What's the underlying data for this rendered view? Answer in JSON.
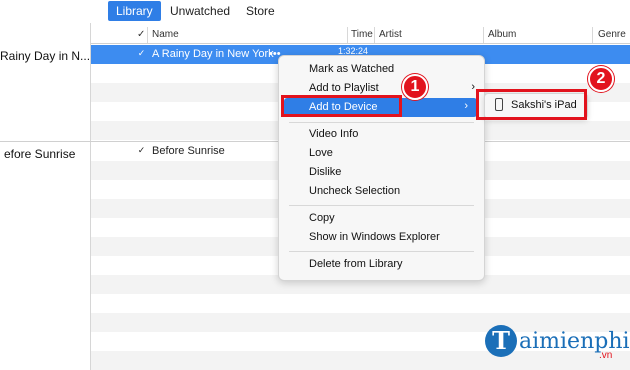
{
  "tabs": [
    "Library",
    "Unwatched",
    "Store"
  ],
  "columns": {
    "check": "✓",
    "name": "Name",
    "time": "Time",
    "artist": "Artist",
    "album": "Album",
    "genre": "Genre"
  },
  "groups": [
    {
      "title": "Rainy Day in N...",
      "track": "A Rainy Day in New York",
      "more": "•••",
      "time": "1:32:24"
    },
    {
      "title": "efore Sunrise",
      "track": "Before Sunrise"
    }
  ],
  "menu": {
    "items": [
      {
        "label": "Mark as Watched"
      },
      {
        "label": "Add to Playlist",
        "submenu": "›"
      },
      {
        "label": "Add to Device",
        "submenu": "›"
      },
      {
        "label": "Video Info"
      },
      {
        "label": "Love"
      },
      {
        "label": "Dislike"
      },
      {
        "label": "Uncheck Selection"
      },
      {
        "label": "Copy"
      },
      {
        "label": "Show in Windows Explorer"
      },
      {
        "label": "Delete from Library"
      }
    ]
  },
  "submenu": {
    "device": "Sakshi's iPad",
    "icon": "tablet-icon"
  },
  "annotations": {
    "step1": "1",
    "step2": "2",
    "color": "#e2131d"
  },
  "watermark": {
    "initial": "T",
    "name": "aimienphi",
    "tld": ".vn"
  },
  "colors": {
    "accent": "#2f7ee6",
    "selection": "#3d8cf0"
  }
}
